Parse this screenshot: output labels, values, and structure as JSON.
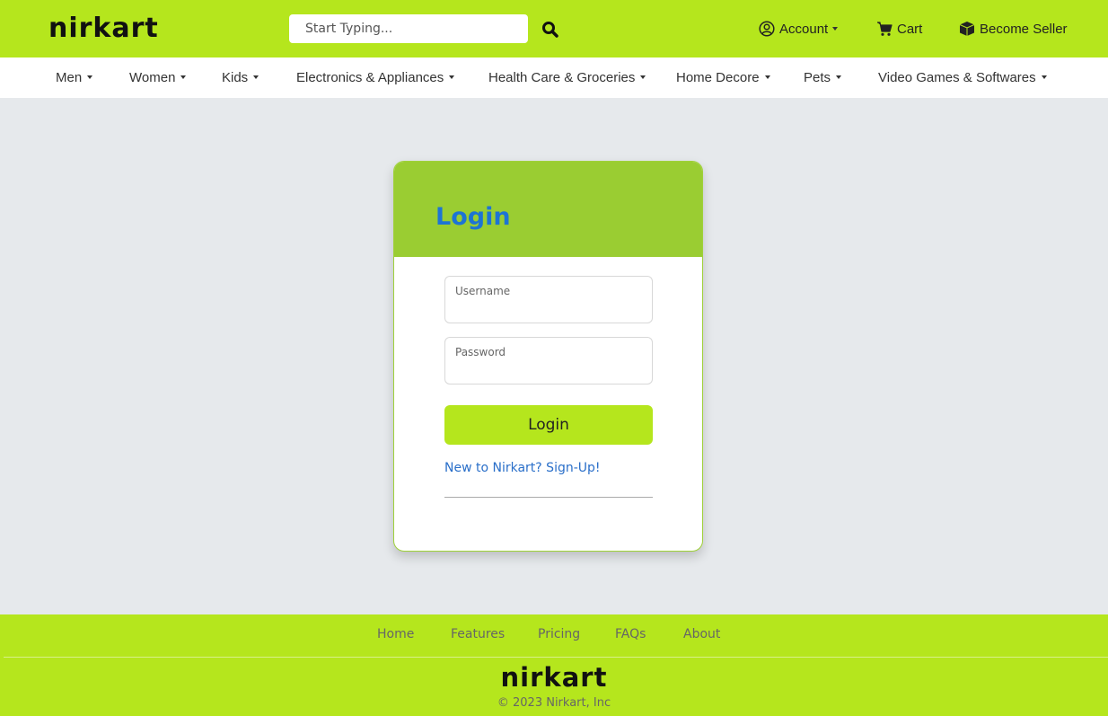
{
  "header": {
    "logo": "nirkart",
    "search_placeholder": "Start Typing...",
    "account_label": "Account",
    "cart_label": "Cart",
    "seller_label": "Become Seller",
    "icons": [
      "search-icon",
      "user-circle-icon",
      "cart-icon",
      "box-icon"
    ]
  },
  "categories": [
    "Men",
    "Women",
    "Kids",
    "Electronics & Appliances",
    "Health Care & Groceries",
    "Home Decore",
    "Pets",
    "Video Games & Softwares"
  ],
  "login": {
    "title": "Login",
    "username_label": "Username",
    "password_label": "Password",
    "button_label": "Login",
    "signup_link": "New to Nirkart? Sign-Up!"
  },
  "footer": {
    "links": [
      "Home",
      "Features",
      "Pricing",
      "FAQs",
      "About"
    ],
    "logo": "nirkart",
    "copyright": "© 2023 Nirkart, Inc"
  },
  "colors": {
    "brand_green": "#b5e61d",
    "card_header": "#9acd32",
    "title_blue": "#1d74d4",
    "link_blue": "#2a6fc9",
    "page_bg": "#e6e9ec"
  }
}
